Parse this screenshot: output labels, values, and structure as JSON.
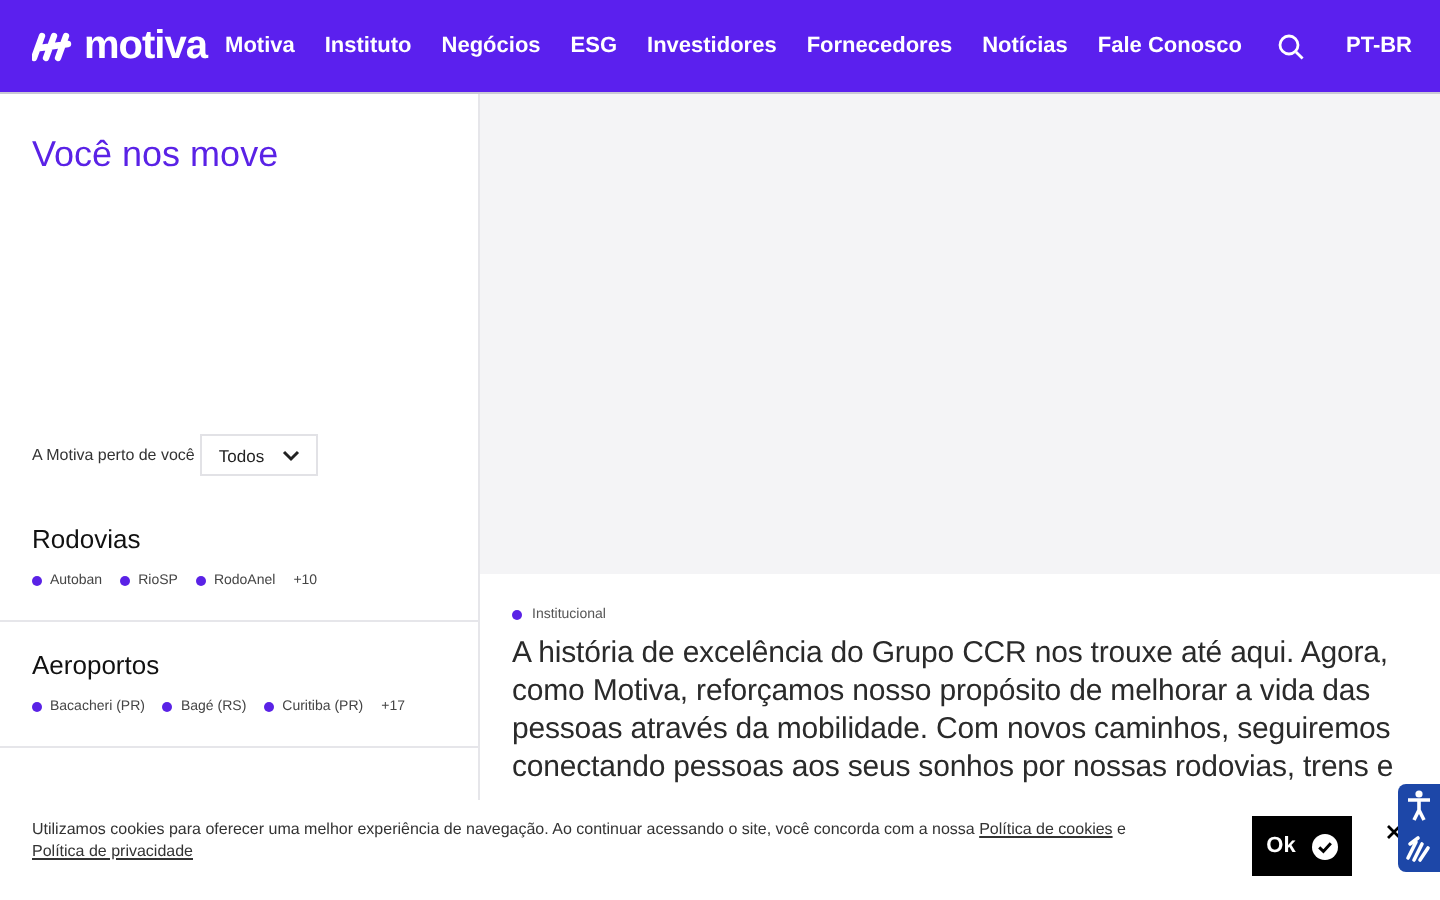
{
  "header": {
    "logo": "motiva",
    "nav": [
      "Motiva",
      "Instituto",
      "Negócios",
      "ESG",
      "Investidores",
      "Fornecedores",
      "Notícias",
      "Fale Conosco"
    ],
    "language": "PT-BR"
  },
  "sidebar": {
    "title": "Você nos move",
    "filter": {
      "label": "A Motiva perto de você",
      "value": "Todos"
    },
    "sections": [
      {
        "title": "Rodovias",
        "items": [
          {
            "name": "Autoban",
            "color": "#5a22e6"
          },
          {
            "name": "RioSP",
            "color": "#5a22e6"
          },
          {
            "name": "RodoAnel",
            "color": "#5a22e6"
          }
        ],
        "more": "+10"
      },
      {
        "title": "Aeroportos",
        "items": [
          {
            "name": "Bacacheri (PR)",
            "color": "#5a22e6"
          },
          {
            "name": "Bagé (RS)",
            "color": "#5a22e6"
          },
          {
            "name": "Curitiba (PR)",
            "color": "#5a22e6"
          }
        ],
        "more": "+17"
      }
    ]
  },
  "article": {
    "tag": {
      "label": "Institucional",
      "color": "#5a22e6"
    },
    "text": "A história de excelência do Grupo CCR nos trouxe até aqui. Agora, como Motiva, reforçamos nosso propósito de melhorar a vida das pessoas através da mobilidade. Com novos caminhos, seguiremos conectando pessoas aos seus sonhos por nossas rodovias, trens e"
  },
  "cookie": {
    "parts": [
      {
        "kind": "text",
        "text": "Utilizamos cookies para oferecer uma melhor experiência de navegação. Ao continuar acessando o site, você concorda com a nossa "
      },
      {
        "kind": "link",
        "text": "Política de cookies"
      },
      {
        "kind": "text",
        "text": " e "
      },
      {
        "kind": "link",
        "text": "Política de privacidade"
      }
    ],
    "button": "Ok"
  }
}
